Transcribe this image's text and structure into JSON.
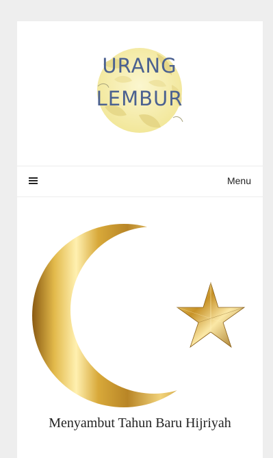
{
  "site": {
    "logo_line1": "URANG",
    "logo_line2": "LEMBUR",
    "logo_text_color": "#4b6190",
    "logo_bg_color": "#f7f0b4"
  },
  "nav": {
    "menu_icon": "hamburger-menu-icon",
    "menu_label": "Menu"
  },
  "post": {
    "image_subject": "crescent-and-star-icon",
    "title": "Menyambut Tahun Baru Hijriyah",
    "accent_color": "#c9a23a"
  }
}
